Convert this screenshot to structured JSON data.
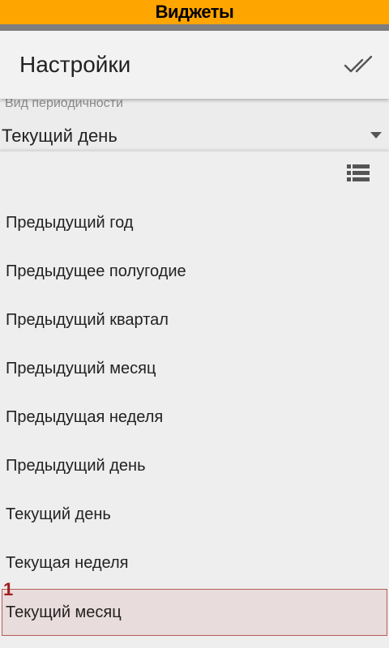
{
  "app": {
    "title": "Виджеты",
    "accent_color": "#ffa500"
  },
  "header": {
    "title": "Настройки",
    "confirm_icon": "double-check-icon"
  },
  "field": {
    "label": "Вид периодичности",
    "value": "Текущий день",
    "arrow_icon": "dropdown-arrow-icon"
  },
  "popup": {
    "list_icon": "list-icon",
    "options": [
      {
        "label": "Предыдущий год"
      },
      {
        "label": "Предыдущее полугодие"
      },
      {
        "label": "Предыдущий квартал"
      },
      {
        "label": "Предыдущий месяц"
      },
      {
        "label": "Предыдущая неделя"
      },
      {
        "label": "Предыдущий день"
      },
      {
        "label": "Текущий день"
      },
      {
        "label": "Текущая неделя"
      },
      {
        "label": "Текущий месяц",
        "marker": "1",
        "highlighted": true
      }
    ]
  }
}
